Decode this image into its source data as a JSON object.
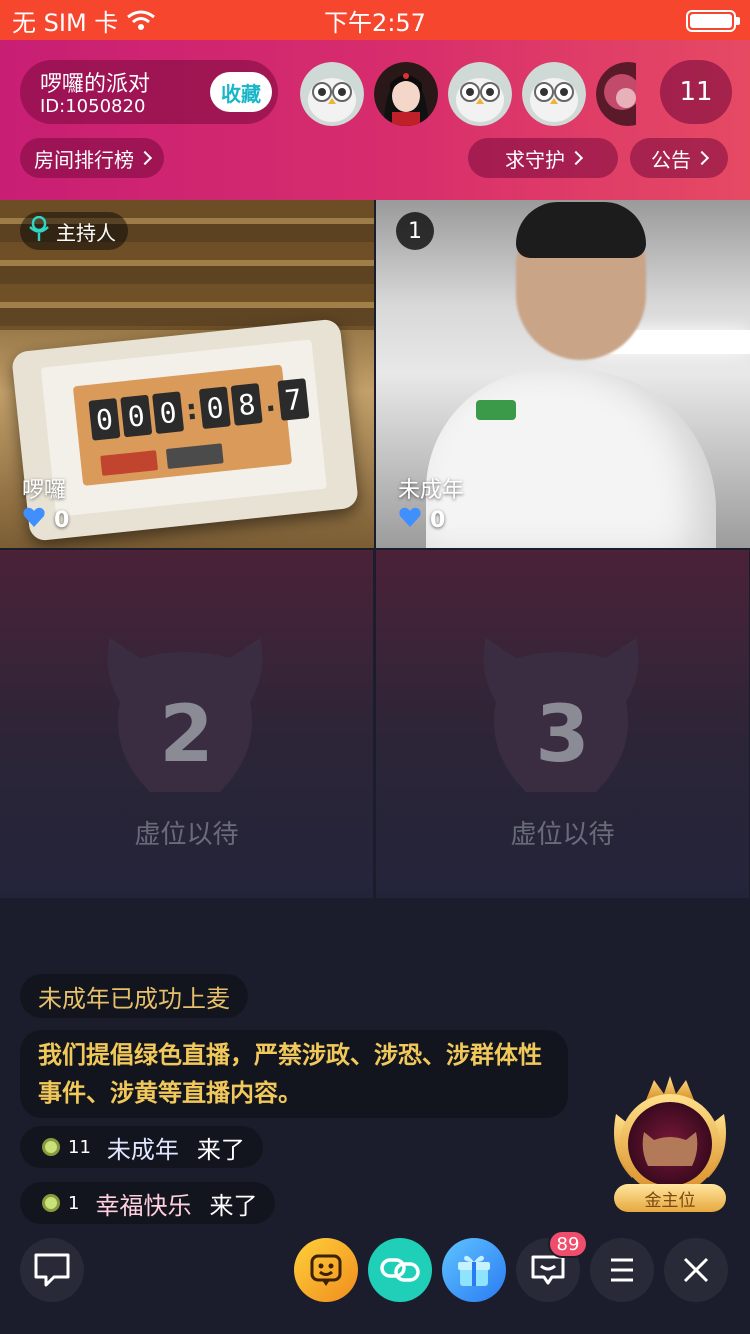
{
  "status_bar": {
    "carrier": "无 SIM 卡",
    "time": "下午2:57",
    "battery_level": 1.0
  },
  "header": {
    "room_name": "啰囉的派对",
    "room_id": "ID:1050820",
    "favorite_label": "收藏",
    "viewer_count": "11",
    "rank_label": "房间排行榜",
    "guard_label": "求守护",
    "notice_label": "公告"
  },
  "seats": {
    "host": {
      "badge": "主持人",
      "name": "啰囉",
      "score": "0"
    },
    "guest1": {
      "badge": "1",
      "name": "未成年",
      "score": "0"
    },
    "empty2": {
      "number": "2",
      "label": "虚位以待"
    },
    "empty3": {
      "number": "3",
      "label": "虚位以待"
    }
  },
  "timer": {
    "digits": [
      "0",
      "0",
      "0",
      "0",
      "8",
      "7"
    ]
  },
  "chat": {
    "system": "未成年已成功上麦",
    "notice": "我们提倡绿色直播，严禁涉政、涉恐、涉群体性事件、涉黄等直播内容。",
    "joins": [
      {
        "level": "11",
        "name": "未成年",
        "text": "来了"
      },
      {
        "level": "1",
        "name": "幸福快乐",
        "text": "来了"
      }
    ]
  },
  "gold_seat_label": "金主位",
  "bottom_bar": {
    "message_badge": "89",
    "icons": [
      "chat-icon",
      "emoji-icon",
      "link-icon",
      "gift-icon",
      "message-icon",
      "menu-icon",
      "close-icon"
    ]
  },
  "colors": {
    "status_bar": "#f7462e",
    "header_start": "#c81e74",
    "header_end": "#e64a63",
    "accent_cyan": "#19b6c9",
    "gold_text": "#e6c06a",
    "badge_red": "#f04d6d"
  }
}
